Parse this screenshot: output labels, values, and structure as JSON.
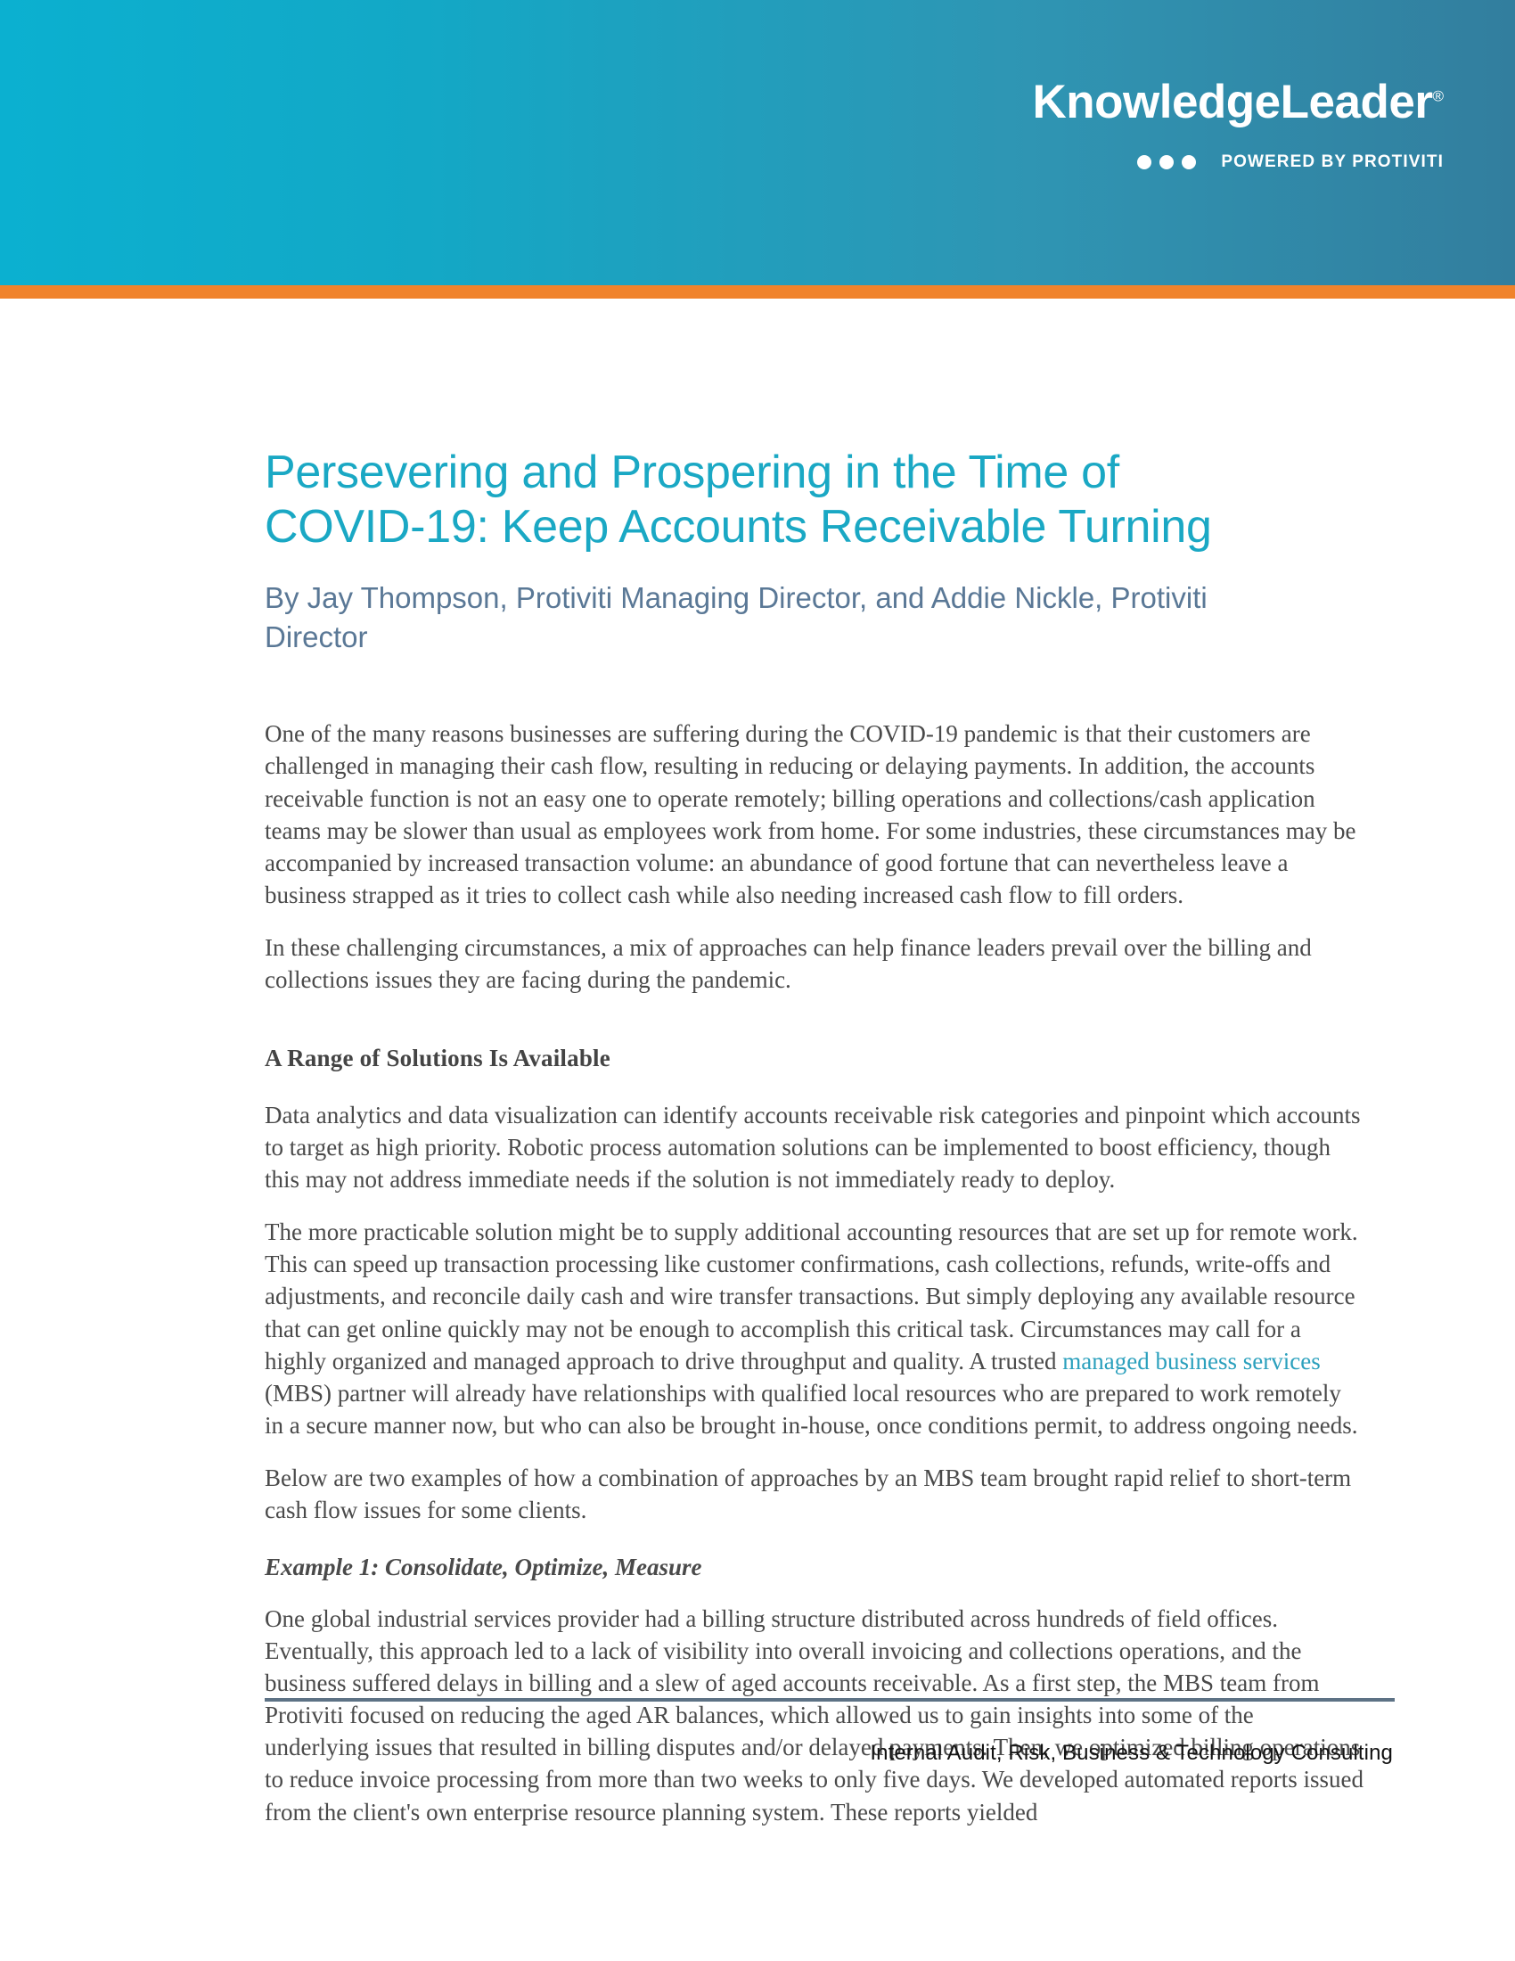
{
  "header": {
    "brand_name": "KnowledgeLeader",
    "brand_registered_mark": "®",
    "brand_tagline": "POWERED BY PROTIVITI",
    "gradient_start_color": "#0bb0d0",
    "gradient_end_color": "#327e9e",
    "accent_bar_color": "#f0832b"
  },
  "document": {
    "title": "Persevering and Prospering in the Time of COVID-19: Keep Accounts Receivable Turning",
    "title_color": "#1aa8c4",
    "byline": "By Jay Thompson, Protiviti Managing Director, and Addie Nickle, Protiviti Director",
    "byline_color": "#5a7896",
    "paragraph_1": "One of the many reasons businesses are suffering during the COVID-19 pandemic is that their customers are challenged in managing their cash flow, resulting in reducing or delaying payments. In addition, the accounts receivable function is not an easy one to operate remotely; billing operations and collections/cash application teams may be slower than usual as employees work from home. For some industries, these circumstances may be accompanied by increased transaction volume: an abundance of good fortune that can nevertheless leave a business strapped as it tries to collect cash while also needing increased cash flow to fill orders.",
    "paragraph_2": "In these challenging circumstances, a mix of approaches can help finance leaders prevail over the billing and collections issues they are facing during the pandemic.",
    "section_heading": "A Range of Solutions Is Available",
    "paragraph_3": "Data analytics and data visualization can identify accounts receivable risk categories and pinpoint which accounts to target as high priority. Robotic process automation solutions can be implemented to boost efficiency, though this may not address immediate needs if the solution is not immediately ready to deploy.",
    "paragraph_4_before_link": "The more practicable solution might be to supply additional accounting resources that are set up for remote work. This can speed up transaction processing like customer confirmations, cash collections, refunds, write-offs and adjustments, and reconcile daily cash and wire transfer transactions. But simply deploying any available resource that can get online quickly may not be enough to accomplish this critical task. Circumstances may call for a highly organized and managed approach to drive throughput and quality. A trusted ",
    "paragraph_4_link_text": "managed business services",
    "paragraph_4_link_color": "#2ba0bd",
    "paragraph_4_after_link": " (MBS) partner will already have relationships with qualified local resources who are prepared to work remotely in a secure manner now, but who can also be brought in-house, once conditions permit, to address ongoing needs.",
    "paragraph_5": "Below are two examples of how a combination of approaches by an MBS team brought rapid relief to short-term cash flow issues for some clients.",
    "example_heading": "Example 1: Consolidate, Optimize, Measure",
    "paragraph_6": "One global industrial services provider had a billing structure distributed across hundreds of field offices. Eventually, this approach led to a lack of visibility into overall invoicing and collections operations, and the business suffered delays in billing and a slew of aged accounts receivable. As a first step, the MBS team from Protiviti focused on reducing the aged AR balances, which allowed us to gain insights into some of the underlying issues that resulted in billing disputes and/or delayed payments. Then, we optimized billing operations to reduce invoice processing from more than two weeks to only five days. We developed automated reports issued from the client's own enterprise resource planning system. These reports yielded"
  },
  "footer": {
    "tagline": "Internal Audit, Risk, Business & Technology Consulting",
    "rule_color": "#5d7285"
  }
}
